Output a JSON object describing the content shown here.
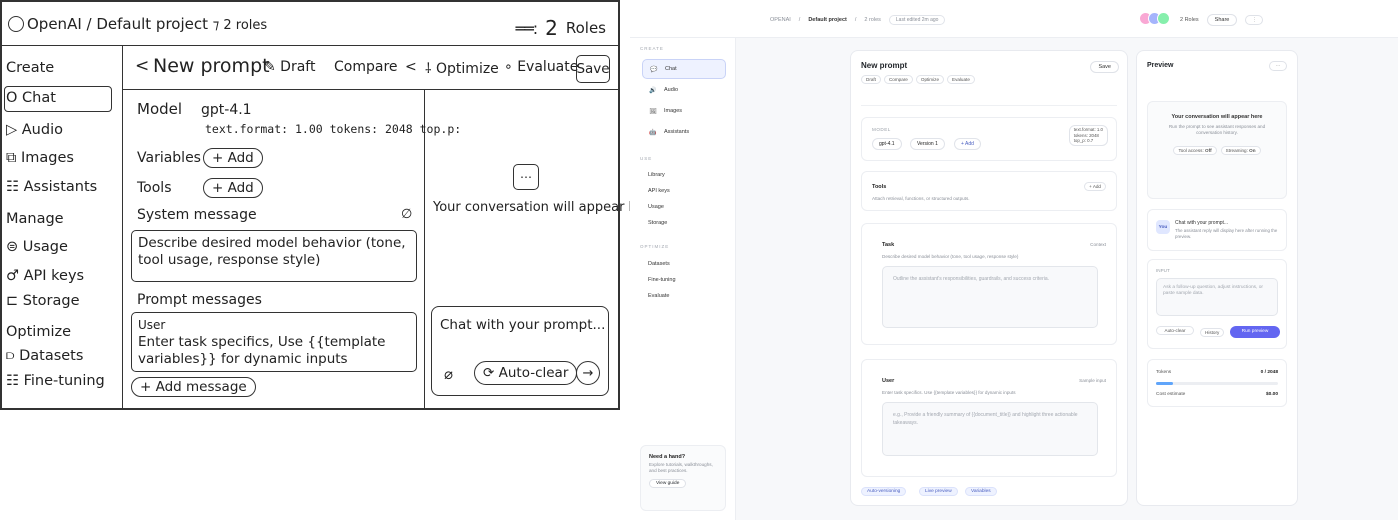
{
  "sketch": {
    "logo": "OpenAI",
    "breadcrumb": "/ Default project",
    "roles_chip": "⁊ 2 roles",
    "roles_count": "2",
    "roles_label": "Roles",
    "sections": {
      "create": "Create",
      "manage": "Manage",
      "optimize": "Optimize"
    },
    "nav": {
      "chat": "O Chat",
      "audio": "▷ Audio",
      "images": "⧉ Images",
      "assistants": "☷ Assistants",
      "usage": "⊜ Usage",
      "api_keys": "♂ API keys",
      "storage": "⊏ Storage",
      "datasets": "⫐ Datasets",
      "fine_tuning": "☷ Fine-tuning"
    },
    "toolbar": {
      "back": "<",
      "title": "New prompt",
      "draft": "✎ Draft",
      "compare": "Compare",
      "chev": "<",
      "optimize": "⸸ Optimize",
      "evaluate": "∘ Evaluate",
      "save": "Save"
    },
    "model_label": "Model",
    "model_value": "gpt-4.1",
    "model_params": "text.format: 1.00 tokens: 2048 top.p:",
    "variables_label": "Variables",
    "tools_label": "Tools",
    "add": "+ Add",
    "system_label": "System message",
    "system_placeholder": "Describe desired model behavior (tone, tool usage, response style)",
    "prompt_label": "Prompt messages",
    "user_label": "User",
    "user_placeholder": "Enter task specifics, Use {{template variables}} for dynamic inputs",
    "add_message": "+ Add message",
    "preview_empty": "Your conversation will appear here",
    "chat_placeholder": "Chat with your prompt...",
    "auto_clear": "Auto-clear",
    "send": "→"
  },
  "app": {
    "breadcrumb": {
      "org": "OPENAI",
      "project": "Default project",
      "roles": "2 roles",
      "edited": "Last edited 2m ago"
    },
    "top": {
      "roles": "2 Roles",
      "share": "Share",
      "more": "⋮"
    },
    "avatar_colors": [
      "#f9a8d4",
      "#a5b4fc",
      "#86efac"
    ],
    "accent": "#6366f1",
    "sidebar": {
      "create_label": "CREATE",
      "use_label": "USE",
      "optimize_label": "OPTIMIZE",
      "create": [
        {
          "label": "Chat",
          "icon": "chat-icon",
          "glyph": "💬"
        },
        {
          "label": "Audio",
          "icon": "audio-icon",
          "glyph": "🔊"
        },
        {
          "label": "Images",
          "icon": "images-icon",
          "glyph": "🖼"
        },
        {
          "label": "Assistants",
          "icon": "assistants-icon",
          "glyph": "🤖"
        }
      ],
      "use": [
        "Library",
        "API keys",
        "Usage",
        "Storage"
      ],
      "optimize": [
        "Datasets",
        "Fine-tuning",
        "Evaluate"
      ],
      "help": {
        "title": "Need a hand?",
        "desc": "Explore tutorials, walkthroughs, and best practices.",
        "button": "View guide"
      }
    },
    "editor": {
      "title": "New prompt",
      "save": "Save",
      "chips": [
        "Draft",
        "Compare",
        "Optimize",
        "Evaluate"
      ],
      "model_label": "MODEL",
      "model_value": "gpt-4.1",
      "version": "Version 1",
      "add": "+ Add",
      "params": "text.format: 1.0\ntokens: 2048\ntop_p: 0.7",
      "tools_title": "Tools",
      "tools_desc": "Attach retrieval, functions, or structured outputs.",
      "tools_add": "+ Add",
      "task_title": "Task",
      "task_hint": "Context",
      "task_desc": "Describe desired model behavior (tone, tool usage, response style)",
      "task_placeholder": "Outline the assistant's responsibilities, guardrails, and success criteria.",
      "user_title": "User",
      "user_hint": "Sample input",
      "user_desc": "Enter task specifics. Use {{template variables}} for dynamic inputs",
      "user_placeholder": "e.g., Provide a friendly summary of {{document_title}} and highlight three actionable takeaways.",
      "tags": [
        "Auto-versioning",
        "Live preview",
        "Variables"
      ]
    },
    "preview": {
      "title": "Preview",
      "more": "⋯",
      "empty_title": "Your conversation will appear here",
      "empty_desc": "Run the prompt to see assistant responses and conversation history.",
      "tool_access_label": "Tool access:",
      "tool_access_value": "Off",
      "streaming_label": "Streaming:",
      "streaming_value": "On",
      "you": "You",
      "chat_title": "Chat with your prompt...",
      "chat_desc": "The assistant reply will display here after running the preview.",
      "input_label": "INPUT",
      "input_placeholder": "Ask a follow-up question, adjust instructions, or paste sample data.",
      "auto_clear": "Auto-clear",
      "history": "History",
      "run": "Run preview",
      "tokens_label": "Tokens",
      "tokens_value": "0 / 2048",
      "tokens_fraction": 0.14,
      "cost_label": "Cost estimate",
      "cost_value": "$0.00"
    }
  }
}
